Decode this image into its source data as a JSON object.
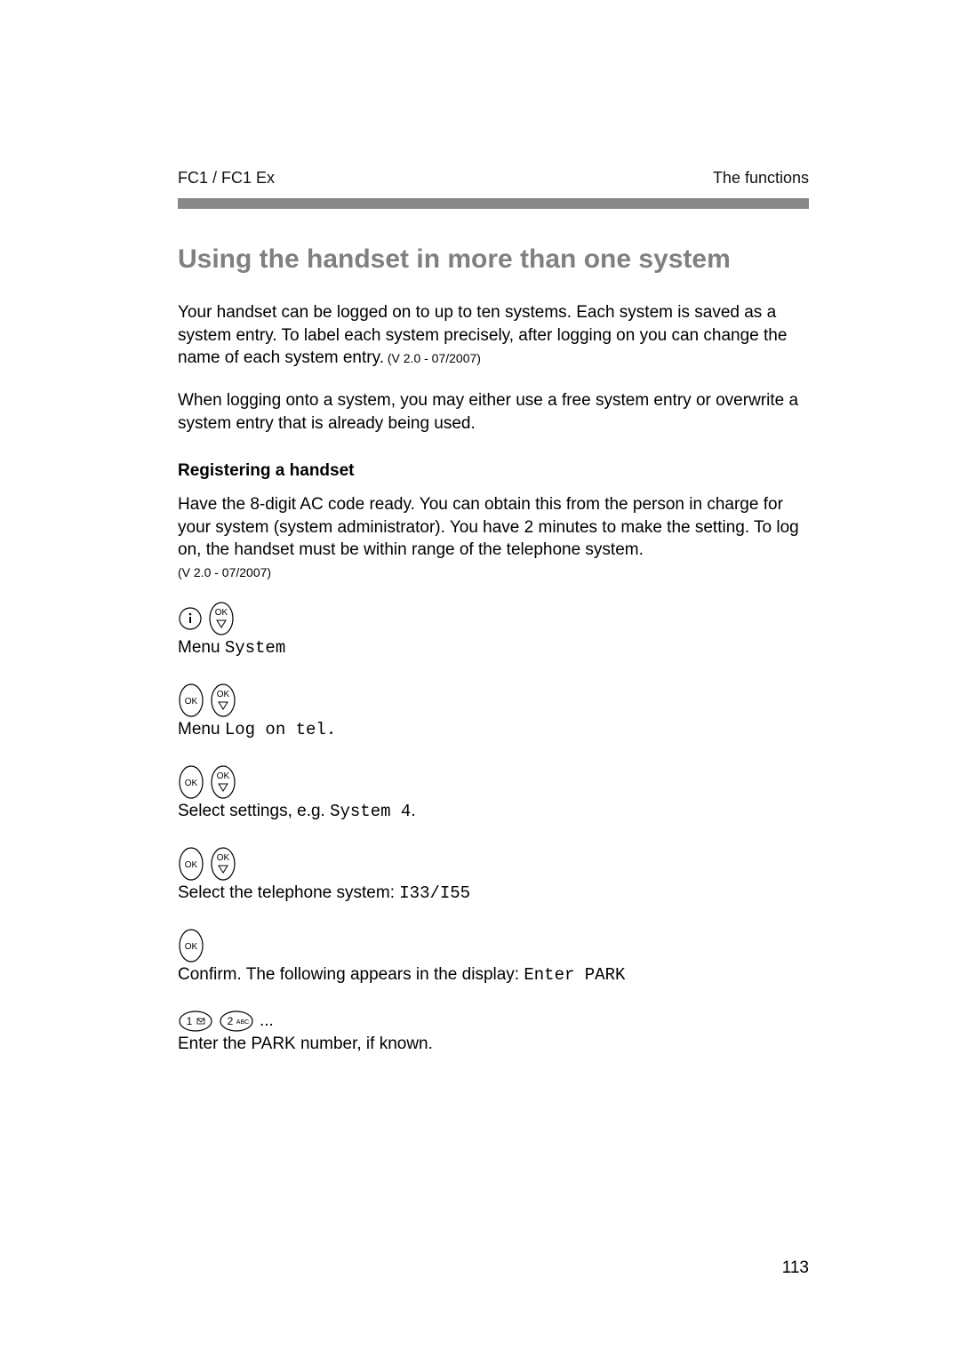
{
  "header": {
    "left": "FC1 / FC1 Ex",
    "right": "The functions"
  },
  "title": "Using the handset in more than one system",
  "para1": "Your handset can be logged on to up to ten systems. Each system is saved as a system entry. To label each system precisely, after logging on you can change the name of each system entry.",
  "para1_note": " (V 2.0 - 07/2007)",
  "para2": "When logging onto a system, you may either use a free system entry or overwrite a system entry that is already being used.",
  "subheading": "Registering a handset",
  "para3": "Have the 8-digit AC code ready. You can obtain this from the person in charge for your system (system administrator). You have 2 minutes to make the setting. To log on, the handset must be within range of the telephone system.",
  "para3_note": "(V 2.0 - 07/2007)",
  "step1": {
    "prefix": "Menu ",
    "mono": "System"
  },
  "step2": {
    "prefix": "Menu ",
    "mono": "Log on tel."
  },
  "step3": {
    "prefix": "Select settings, e.g. ",
    "mono": "System 4",
    "suffix": "."
  },
  "step4": {
    "prefix": "Select the telephone system: ",
    "mono": "I33/I55"
  },
  "step5": {
    "prefix": "Confirm. The following appears in the display: ",
    "mono": "Enter PARK"
  },
  "step6_icons": {
    "dots": " ...",
    "label": "Enter the PARK number, if known."
  },
  "page_number": "113"
}
